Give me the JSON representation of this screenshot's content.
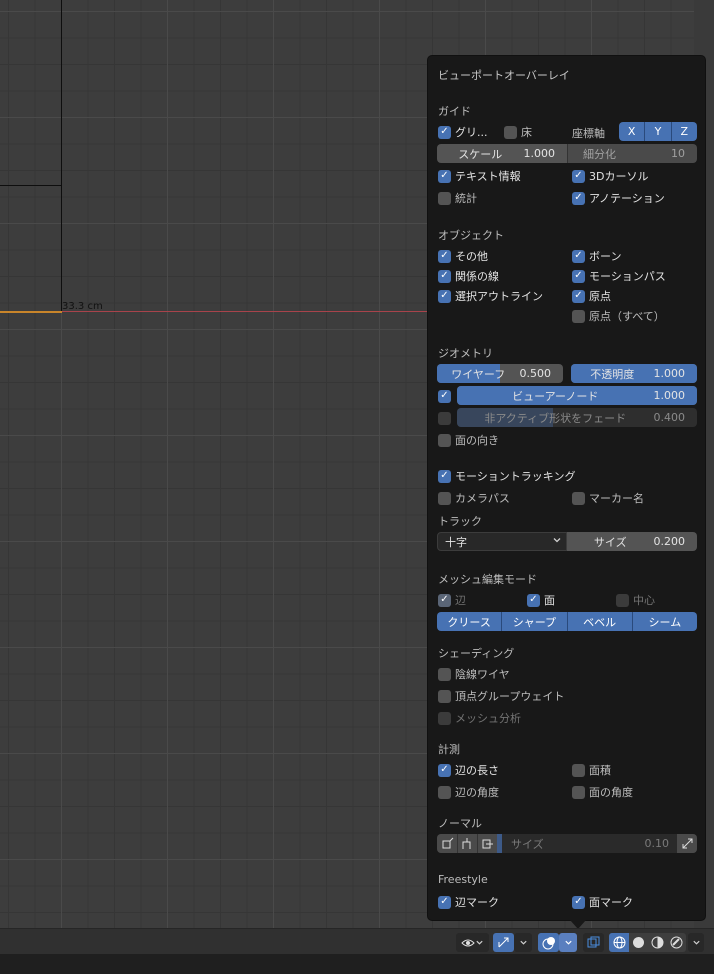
{
  "viewport": {
    "dimension_label": "33.3 cm"
  },
  "overlay": {
    "title": "ビューポートオーバーレイ",
    "guides": {
      "heading": "ガイド",
      "grid": {
        "label": "グリ...",
        "checked": true
      },
      "floor": {
        "label": "床",
        "checked": false
      },
      "axes_label": "座標軸",
      "axes": [
        "X",
        "Y",
        "Z"
      ],
      "scale": {
        "label": "スケール",
        "value": "1.000"
      },
      "subdivisions": {
        "label": "細分化",
        "value": "10"
      },
      "text_info": {
        "label": "テキスト情報",
        "checked": true
      },
      "cursor_3d": {
        "label": "3Dカーソル",
        "checked": true
      },
      "statistics": {
        "label": "統計",
        "checked": false
      },
      "annotations": {
        "label": "アノテーション",
        "checked": true
      }
    },
    "objects": {
      "heading": "オブジェクト",
      "extras": {
        "label": "その他",
        "checked": true
      },
      "bones": {
        "label": "ボーン",
        "checked": true
      },
      "relationship_lines": {
        "label": "関係の線",
        "checked": true
      },
      "motion_paths": {
        "label": "モーションパス",
        "checked": true
      },
      "outline_selected": {
        "label": "選択アウトライン",
        "checked": true
      },
      "origins": {
        "label": "原点",
        "checked": true
      },
      "origins_all": {
        "label": "原点（すべて）",
        "checked": false
      }
    },
    "geometry": {
      "heading": "ジオメトリ",
      "wireframe": {
        "label": "ワイヤーフ",
        "value": "0.500",
        "fraction": 0.5
      },
      "opacity": {
        "label": "不透明度",
        "value": "1.000",
        "fraction": 1.0
      },
      "viewer_node": {
        "label": "ビューアーノード",
        "value": "1.000",
        "checked": true,
        "fraction": 1.0
      },
      "fade_inactive": {
        "label": "非アクティブ形状をフェード",
        "value": "0.400",
        "checked": false,
        "fraction": 0.4
      },
      "face_orientation": {
        "label": "面の向き",
        "checked": false
      }
    },
    "motion_tracking": {
      "label": "モーショントラッキング",
      "checked": true,
      "camera_path": {
        "label": "カメラパス",
        "checked": false
      },
      "marker_names": {
        "label": "マーカー名",
        "checked": false
      },
      "track_heading": "トラック",
      "track_type": "十字",
      "size": {
        "label": "サイズ",
        "value": "0.200"
      }
    },
    "mesh_edit": {
      "heading": "メッシュ編集モード",
      "edges": {
        "label": "辺",
        "checked": true
      },
      "faces": {
        "label": "面",
        "checked": true
      },
      "center": {
        "label": "中心",
        "checked": false
      },
      "buttons": [
        "クリース",
        "シャープ",
        "ベベル",
        "シーム"
      ]
    },
    "shading": {
      "heading": "シェーディング",
      "hidden_wire": {
        "label": "陰線ワイヤ",
        "checked": false
      },
      "vertex_group_weights": {
        "label": "頂点グループウェイト",
        "checked": false
      },
      "mesh_analysis": {
        "label": "メッシュ分析",
        "checked": false
      }
    },
    "measurement": {
      "heading": "計測",
      "edge_length": {
        "label": "辺の長さ",
        "checked": true
      },
      "face_area": {
        "label": "面積",
        "checked": false
      },
      "edge_angle": {
        "label": "辺の角度",
        "checked": false
      },
      "face_angle": {
        "label": "面の角度",
        "checked": false
      }
    },
    "normals": {
      "heading": "ノーマル",
      "size": {
        "label": "サイズ",
        "value": "0.10"
      }
    },
    "freestyle": {
      "heading": "Freestyle",
      "edge_marks": {
        "label": "辺マーク",
        "checked": true
      },
      "face_marks": {
        "label": "面マーク",
        "checked": true
      }
    }
  },
  "colors": {
    "accent": "#4772b3",
    "panel": "#181818",
    "x_axis": "#a8434b",
    "camera": "#c9852a"
  }
}
